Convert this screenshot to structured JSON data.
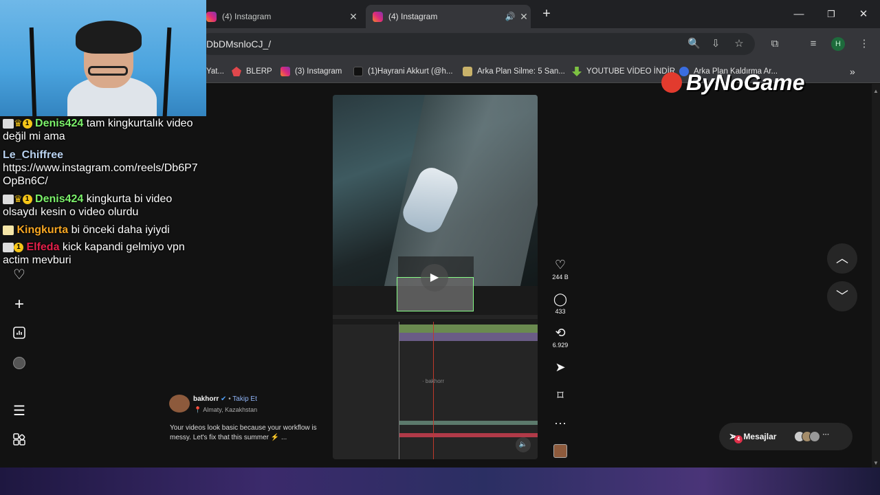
{
  "browser": {
    "tabs": [
      {
        "label": "(4) Instagram",
        "active": false,
        "close": "✕"
      },
      {
        "label": "(4) Instagram",
        "active": true,
        "close": "✕"
      }
    ],
    "new_tab": "+",
    "address": "DbDMsnloCJ_/",
    "profile_initial": "H",
    "bookmarks": [
      {
        "label": "Yat...",
        "color": "#e2a33a"
      },
      {
        "label": "BLERP",
        "color": "#e0474c"
      },
      {
        "label": "(3) Instagram",
        "color": "#dd2a7b"
      },
      {
        "label": "(1)Hayrani Akkurt (@h...",
        "color": "#111111"
      },
      {
        "label": "Arka Plan Silme: 5 San...",
        "color": "#c8b26a"
      },
      {
        "label": "YOUTUBE VİDEO İNDİR",
        "color": "#7dc242"
      },
      {
        "label": "Arka Plan Kaldırma Ar...",
        "color": "#3a6de0"
      }
    ],
    "more_bookmarks": "»"
  },
  "overlay": {
    "watermark": "ByNoGame"
  },
  "chat": {
    "messages": [
      {
        "user": "Denis424",
        "user_color": "#7cf26b",
        "text": "tam kingkurtalık video değil mi ama",
        "badges": "crown-1"
      },
      {
        "user": "Le_Chiffree",
        "user_color": "#b9d2f0",
        "text": "https://www.instagram.com/reels/Db6P7OpBn6C/",
        "badges": "none"
      },
      {
        "user": "Denis424",
        "user_color": "#7cf26b",
        "text": "kingkurta bi video olsaydı kesin o video olurdu",
        "badges": "crown-1"
      },
      {
        "user": "Kingkurta",
        "user_color": "#f5a623",
        "text": "bi önceki daha iyiydi",
        "badges": "mod"
      },
      {
        "user": "Elfeda",
        "user_color": "#e3204a",
        "text": "kick kapandi gelmiyo vpn actim mevburi",
        "badges": "1"
      }
    ]
  },
  "reel": {
    "author": "bakhorr",
    "follow": "Takip Et",
    "location": "Almaty, Kazakhstan",
    "caption": "Your videos look basic because your workflow is messy. Let's fix that this summer",
    "caption_more": "...",
    "watermark": "· bakhorr",
    "likes": "244 B",
    "comments": "433",
    "reposts": "6.929"
  },
  "messages_button": {
    "label": "Mesajlar",
    "badge": "4"
  }
}
